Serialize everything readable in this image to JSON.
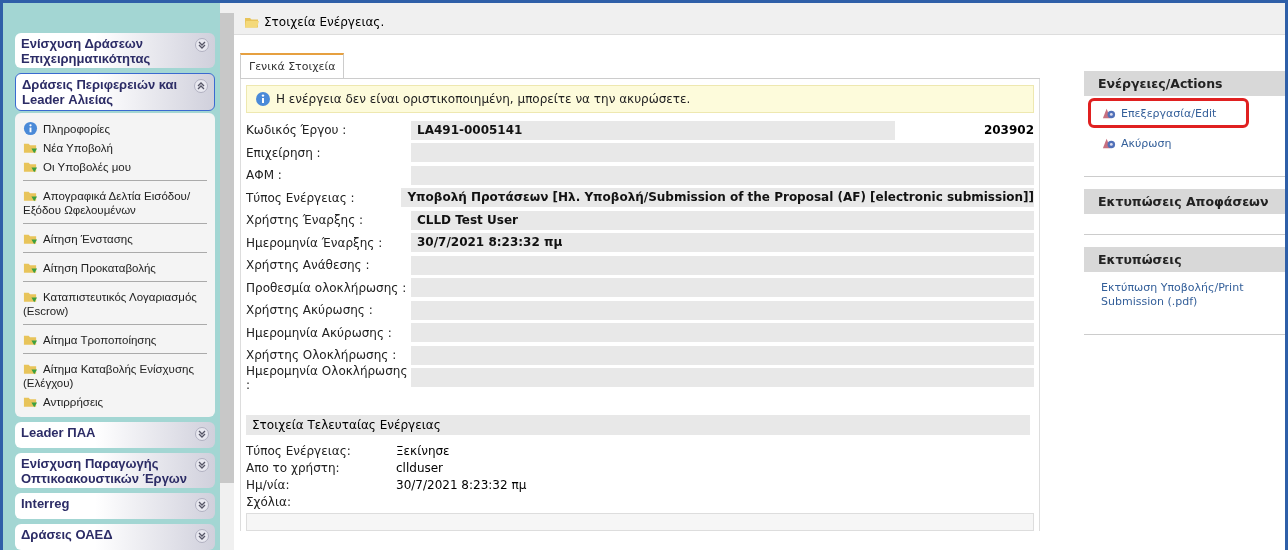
{
  "sidebar": {
    "sections": [
      {
        "title": "Ενίσχυση Δράσεων Επιχειρηματικότητας",
        "expanded": false
      },
      {
        "title": "Δράσεις Περιφερειών και Leader Αλιείας",
        "expanded": true,
        "groups": [
          [
            {
              "label": "Πληροφορίες",
              "kind": "info"
            },
            {
              "label": "Νέα Υποβολή",
              "kind": "folder"
            },
            {
              "label": "Οι Υποβολές μου",
              "kind": "folder"
            }
          ],
          [
            {
              "label": "Απογραφικά Δελτία Εισόδου/ Εξόδου Ωφελουμένων",
              "kind": "folder"
            }
          ],
          [
            {
              "label": "Αίτηση Ένστασης",
              "kind": "folder"
            }
          ],
          [
            {
              "label": "Αίτηση Προκαταβολής",
              "kind": "folder"
            }
          ],
          [
            {
              "label": "Καταπιστευτικός Λογαριασμός (Escrow)",
              "kind": "folder"
            }
          ],
          [
            {
              "label": "Αίτημα Τροποποίησης",
              "kind": "folder"
            }
          ],
          [
            {
              "label": "Αίτημα Καταβολής Ενίσχυσης (Ελέγχου)",
              "kind": "folder"
            },
            {
              "label": "Αντιρρήσεις",
              "kind": "folder"
            }
          ]
        ]
      },
      {
        "title": "Leader ΠΑΑ",
        "expanded": false
      },
      {
        "title": "Ενίσχυση Παραγωγής Οπτικοακουστικών Έργων",
        "expanded": false
      },
      {
        "title": "Interreg",
        "expanded": false
      },
      {
        "title": "Δράσεις ΟΑΕΔ",
        "expanded": false
      }
    ]
  },
  "header": {
    "title": "Στοιχεία Ενέργειας."
  },
  "tabs": [
    {
      "label": "Γενικά Στοιχεία",
      "selected": true
    }
  ],
  "notice": "Η ενέργεια δεν είναι οριστικοποιημένη, μπορείτε να την ακυρώσετε.",
  "fields": [
    {
      "label": "Κωδικός Έργου :",
      "value": "LA491-0005141",
      "extra": "203902"
    },
    {
      "label": "Επιχείρηση :"
    },
    {
      "label": "ΑΦΜ :"
    },
    {
      "label": "Τύπος Ενέργειας :",
      "value": "Υποβολή Προτάσεων [Ηλ. Υποβολή/Submission of the Proposal (AF) [electronic submission]]"
    },
    {
      "label": "Χρήστης Έναρξης :",
      "value": "CLLD Test User"
    },
    {
      "label": "Ημερομηνία Έναρξης :",
      "value": "30/7/2021 8:23:32 πμ"
    },
    {
      "label": "Χρήστης Ανάθεσης :"
    },
    {
      "label": "Προθεσμία ολοκλήρωσης :"
    },
    {
      "label": "Χρήστης Ακύρωσης :"
    },
    {
      "label": "Ημερομηνία Ακύρωσης :"
    },
    {
      "label": "Χρήστης Ολοκλήρωσης :"
    },
    {
      "label": "Ημερομηνία Ολοκλήρωσης :"
    }
  ],
  "last_action": {
    "title": "Στοιχεία Τελευταίας Ενέργειας",
    "rows": [
      {
        "label": "Τύπος Ενέργειας:",
        "value": "Ξεκίνησε"
      },
      {
        "label": "Απο το χρήστη:",
        "value": "cllduser"
      },
      {
        "label": "Ημ/νία:",
        "value": "30/7/2021 8:23:32 πμ"
      }
    ],
    "comments_label": "Σχόλια:"
  },
  "panels": [
    {
      "title": "Ενέργειες/Actions",
      "links": [
        {
          "label": "Επεξεργασία/Edit",
          "kind": "icon",
          "highlighted": true
        },
        {
          "label": "Ακύρωση",
          "kind": "icon",
          "highlighted": false
        }
      ]
    },
    {
      "title": "Εκτυπώσεις Αποφάσεων"
    },
    {
      "title": "Εκτυπώσεις",
      "links": [
        {
          "label": "Εκτύπωση Υποβολής/Print Submission (.pdf)",
          "kind": "plain",
          "highlighted": false
        }
      ]
    }
  ]
}
